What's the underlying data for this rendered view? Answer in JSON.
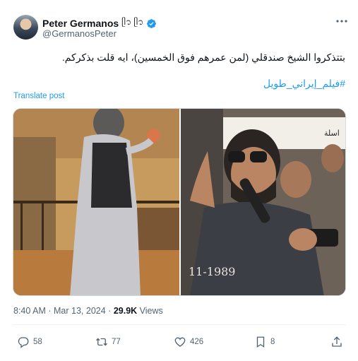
{
  "author": {
    "display_name": "Peter Germanos",
    "name_suffix": "ᥫ᭡ ᥫ᭡",
    "handle": "@GermanosPeter"
  },
  "tweet": {
    "text": "بتتذكروا الشيخ صندقلي (لمن عمرهم فوق الخمسين)، ايه قلت بذكركم.",
    "hashtag": "#فيلم_إيراني_طويل",
    "translate_label": "Translate post"
  },
  "media": {
    "right_caption": "11-1989",
    "sign_text": "اسلة"
  },
  "meta": {
    "time": "8:40 AM",
    "separator": "·",
    "date": "Mar 13, 2024",
    "views_count": "29.9K",
    "views_label": "Views"
  },
  "actions": {
    "replies": "58",
    "reposts": "77",
    "likes": "426",
    "bookmarks": "8"
  },
  "colors": {
    "accent": "#1d9bf0",
    "secondary_text": "#536471"
  }
}
